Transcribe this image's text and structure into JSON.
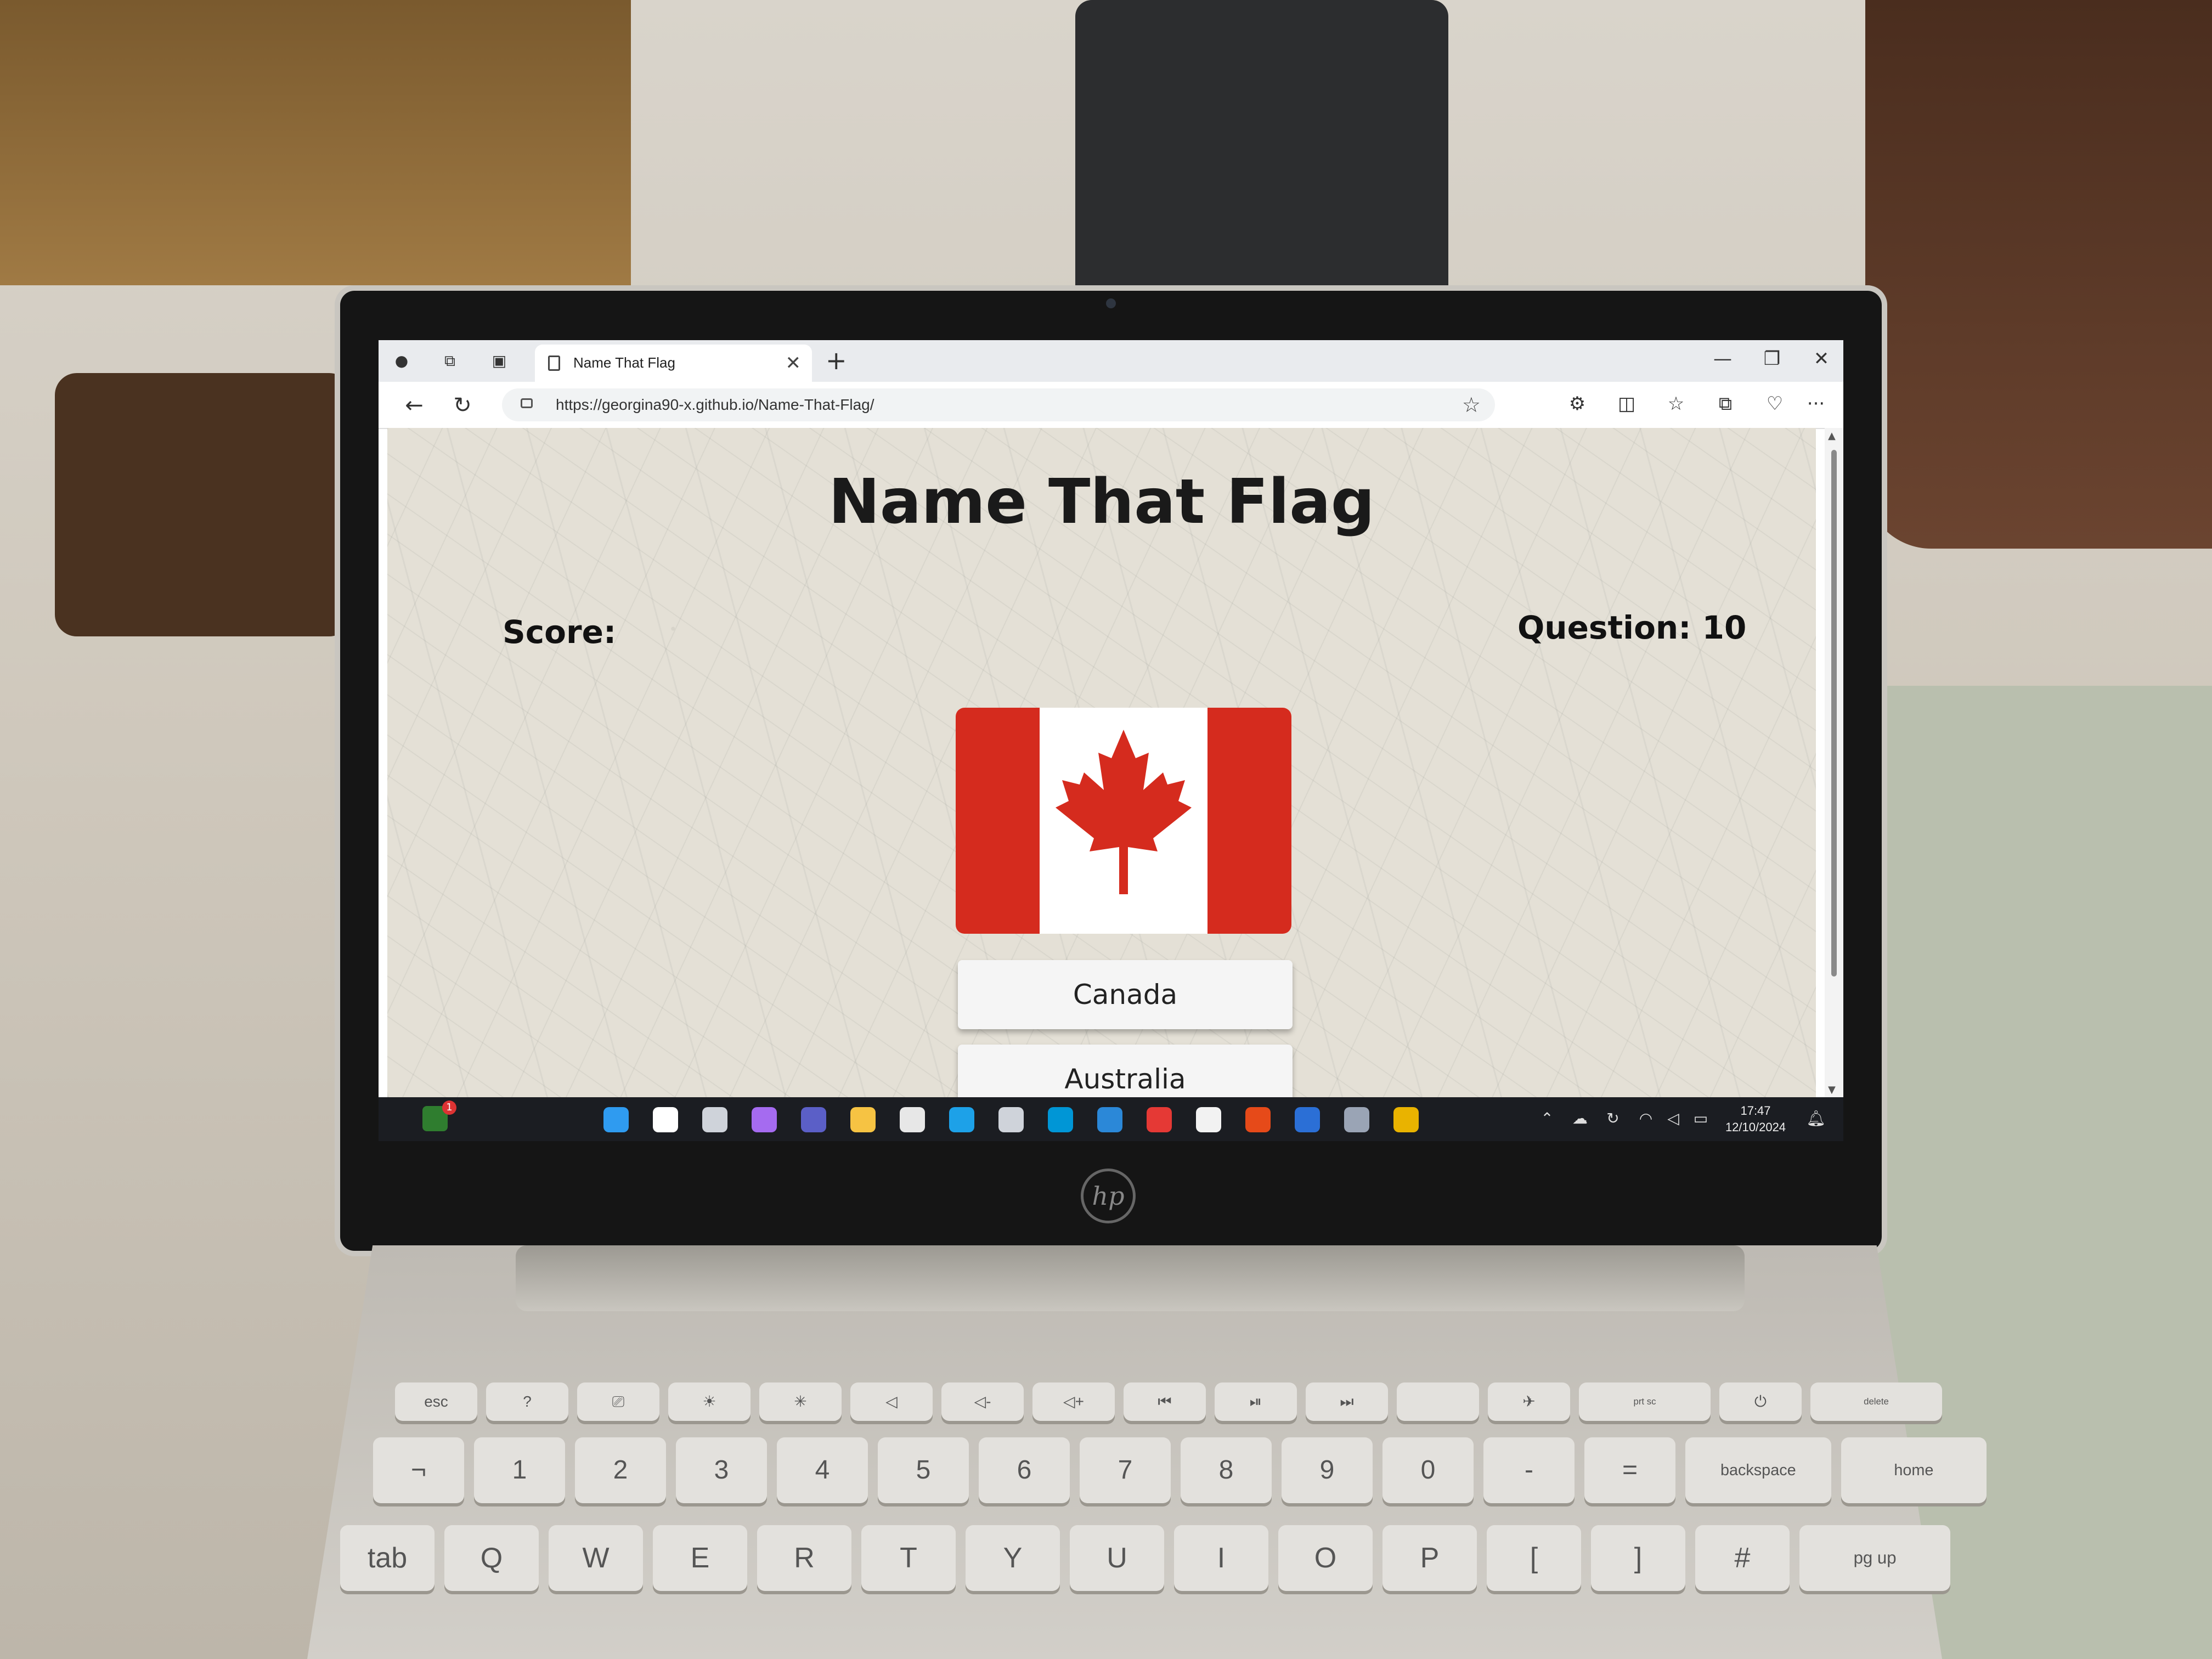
{
  "browser": {
    "tab_title": "Name That Flag",
    "tab_close": "✕",
    "new_tab": "+",
    "window_controls": [
      "—",
      "❐",
      "✕"
    ],
    "url": "https://georgina90-x.github.io/Name-That-Flag/",
    "nav": {
      "back": "←",
      "refresh": "↻"
    },
    "tools": [
      "⚙",
      "◫",
      "☆",
      "⧉",
      "♡",
      "···"
    ]
  },
  "page": {
    "title": "Name That Flag",
    "score_label": "Score:",
    "question_label": "Question: 10",
    "flag": {
      "country_icon": "canada-flag",
      "red": "#d52b1e",
      "white": "#ffffff"
    },
    "answers": [
      "Canada",
      "Australia"
    ]
  },
  "taskbar": {
    "weather_badge": "1",
    "time": "17:47",
    "date": "12/10/2024",
    "apps": [
      {
        "icon": "windows-start-icon",
        "color": "#2f9bf0"
      },
      {
        "icon": "search-icon",
        "color": "#ffffff"
      },
      {
        "icon": "task-view-icon",
        "color": "#cfd3da"
      },
      {
        "icon": "copilot-icon",
        "color": "#a56bf0"
      },
      {
        "icon": "teams-icon",
        "color": "#5b5fc7"
      },
      {
        "icon": "file-explorer-icon",
        "color": "#f6c343"
      },
      {
        "icon": "widgets-icon",
        "color": "#e7e7e7"
      },
      {
        "icon": "edge-icon",
        "color": "#1da1e8"
      },
      {
        "icon": "store-icon",
        "color": "#cfd3da"
      },
      {
        "icon": "myhp-icon",
        "color": "#0096d6"
      },
      {
        "icon": "help-icon",
        "color": "#2b88d8"
      },
      {
        "icon": "youtube-icon",
        "color": "#e53935"
      },
      {
        "icon": "amazon-icon",
        "color": "#f2f2f2"
      },
      {
        "icon": "office-icon",
        "color": "#e64a19"
      },
      {
        "icon": "gift-icon",
        "color": "#2b6fd6"
      },
      {
        "icon": "snipping-icon",
        "color": "#9aa4b5"
      },
      {
        "icon": "chrome-icon",
        "color": "#e9b300"
      }
    ]
  },
  "keyboard": {
    "row_fn": [
      "esc",
      "?",
      "⎚",
      "☀",
      "✳",
      "◁",
      "◁-",
      "◁+",
      "⏮",
      "⏯",
      "⏭",
      "",
      "✈",
      "prt sc",
      "⏻",
      "delete"
    ],
    "row_num": [
      "¬",
      "1",
      "2",
      "3",
      "4",
      "5",
      "6",
      "7",
      "8",
      "9",
      "0",
      "-",
      "=",
      "backspace",
      "home"
    ],
    "row_q": [
      "tab",
      "Q",
      "W",
      "E",
      "R",
      "T",
      "Y",
      "U",
      "I",
      "O",
      "P",
      "[",
      "]",
      "#",
      "pg up"
    ]
  }
}
